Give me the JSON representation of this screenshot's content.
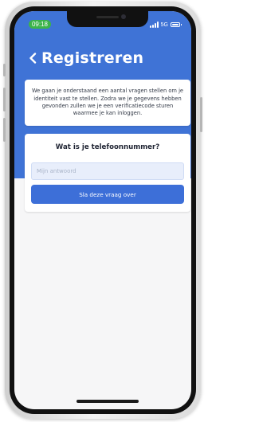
{
  "status_bar": {
    "time": "09:18",
    "network": "5G",
    "time_pill_color": "#3cb44a"
  },
  "header": {
    "back_icon": "chevron-left-icon",
    "title": "Registreren",
    "background_color": "#3f73d6"
  },
  "intro": {
    "text": "We gaan je onderstaand een aantal vragen stellen om je identiteit vast te stellen. Zodra we je gegevens hebben gevonden zullen we je een verificatiecode sturen waarmee je kan inloggen."
  },
  "question_card": {
    "question": "Wat is je telefoonnummer?",
    "answer_value": "",
    "answer_placeholder": "Mijn antwoord",
    "skip_label": "Sla deze vraag over",
    "button_color": "#3d6fd8"
  }
}
